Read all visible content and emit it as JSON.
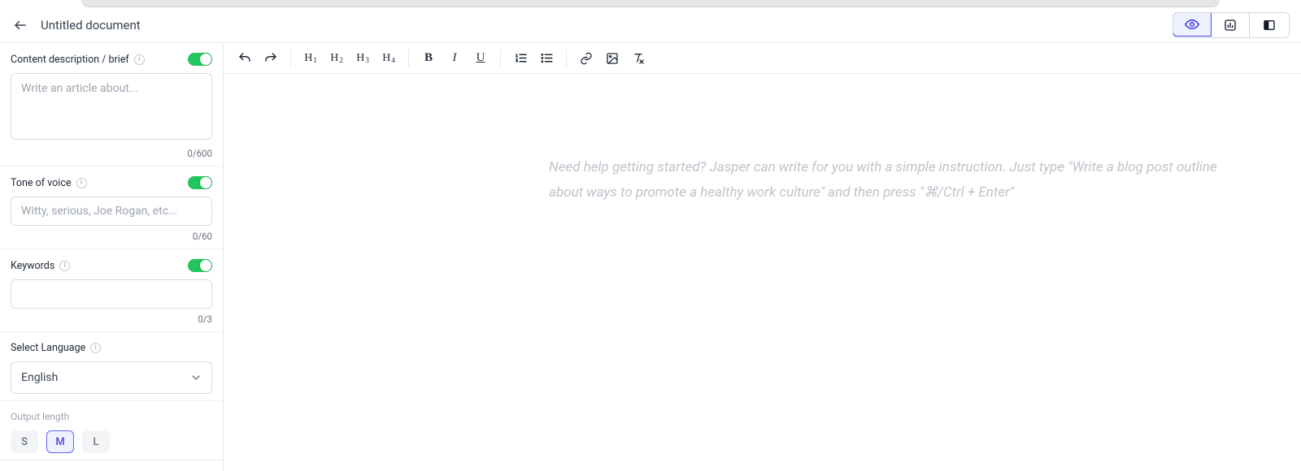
{
  "header": {
    "title": "Untitled document"
  },
  "sidebar": {
    "brief": {
      "label": "Content description / brief",
      "placeholder": "Write an article about...",
      "counter": "0/600"
    },
    "tone": {
      "label": "Tone of voice",
      "placeholder": "Witty, serious, Joe Rogan, etc...",
      "counter": "0/60"
    },
    "keywords": {
      "label": "Keywords",
      "counter": "0/3"
    },
    "language": {
      "label": "Select Language",
      "value": "English"
    },
    "output_length": {
      "label": "Output length",
      "options": {
        "s": "S",
        "m": "M",
        "l": "L"
      }
    }
  },
  "editor": {
    "hint": "Need help getting started? Jasper can write for you with a simple instruction. Just type \"Write a blog post outline about ways to promote a healthy work culture\" and then press \"⌘/Ctrl + Enter\""
  }
}
